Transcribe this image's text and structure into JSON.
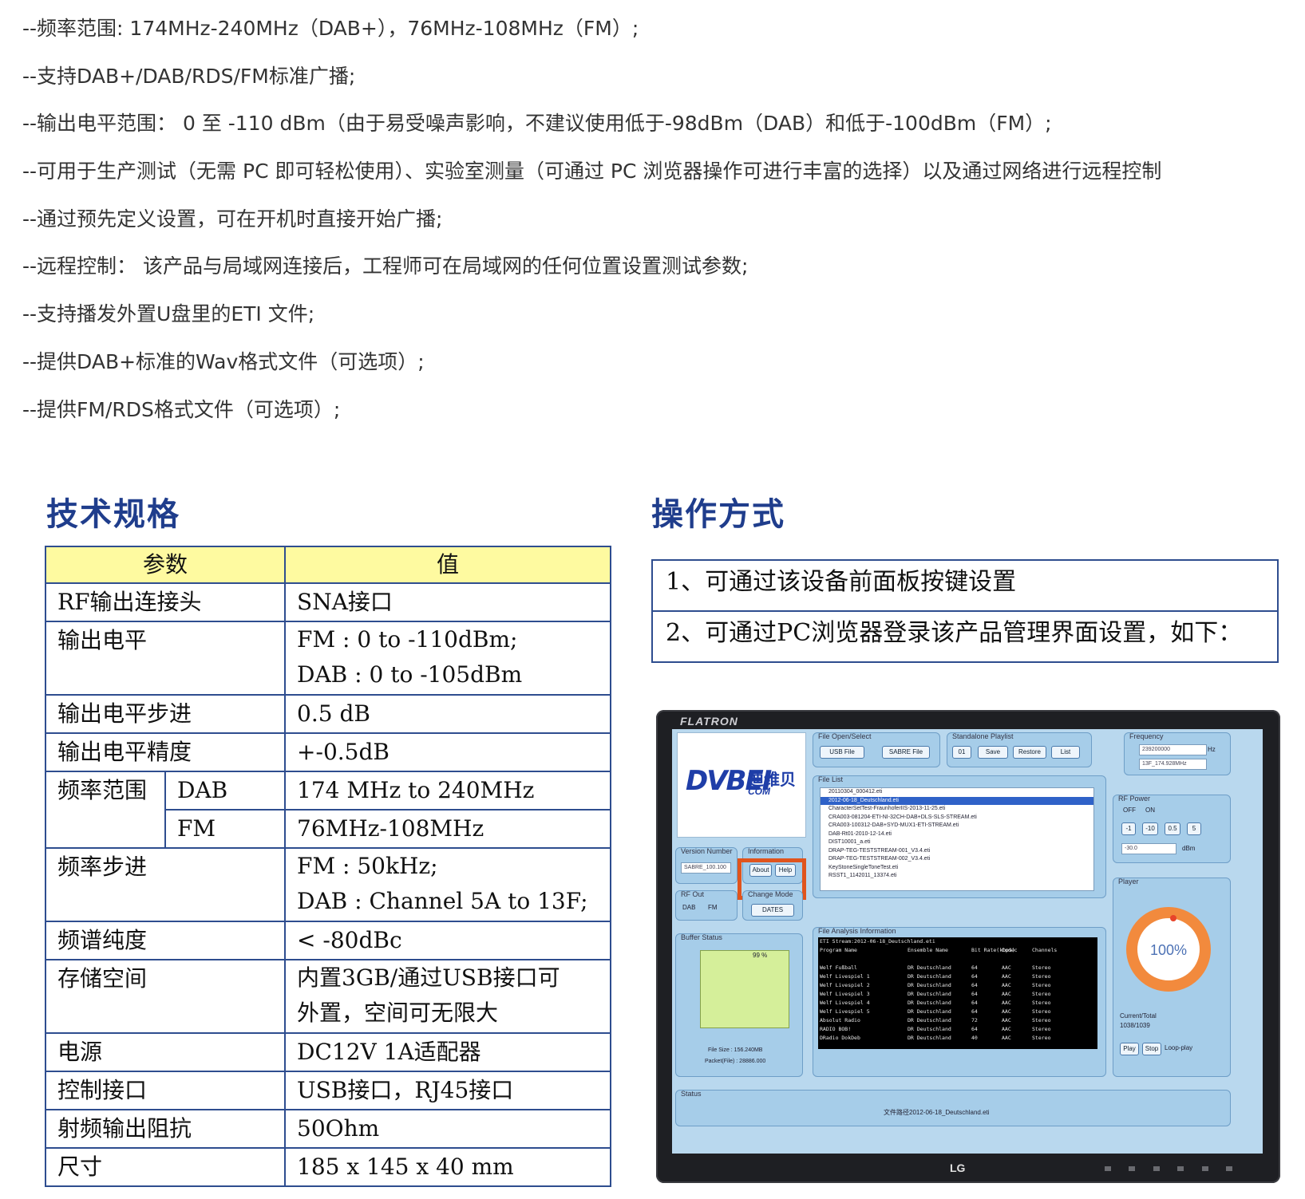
{
  "features": [
    "--频率范围: 174MHz-240MHz（DAB+），76MHz-108MHz（FM）;",
    "--支持DAB+/DAB/RDS/FM标准广播;",
    "--输出电平范围： 0 至 -110 dBm（由于易受噪声影响，不建议使用低于-98dBm（DAB）和低于-100dBm（FM）;",
    "--可用于生产测试（无需 PC 即可轻松使用）、实验室测量（可通过 PC 浏览器操作可进行丰富的选择）以及通过网络进行远程控制",
    "--通过预先定义设置，可在开机时直接开始广播;",
    "--远程控制： 该产品与局域网连接后，工程师可在局域网的任何位置设置测试参数;",
    "--支持播发外置U盘里的ETI 文件;",
    "--提供DAB+标准的Wav格式文件（可选项）;",
    "--提供FM/RDS格式文件（可选项）;"
  ],
  "spec_heading": "技术规格",
  "ops_heading": "操作方式",
  "spec_table": {
    "header": [
      "参数",
      "值"
    ],
    "rows": [
      {
        "param": "RF输出连接头",
        "value": "SNA接口"
      },
      {
        "param": "输出电平",
        "value": "FM : 0 to -110dBm;",
        "value2": "DAB : 0 to -105dBm"
      },
      {
        "param": "输出电平步进",
        "value": "0.5 dB"
      },
      {
        "param": "输出电平精度",
        "value": "+-0.5dB"
      },
      {
        "param": "频率范围",
        "sub1": "DAB",
        "value_dab": "174 MHz to 240MHz",
        "sub2": "FM",
        "value_fm": "76MHz-108MHz"
      },
      {
        "param": "频率步进",
        "value": "FM : 50kHz;",
        "value2": "DAB : Channel 5A to 13F;"
      },
      {
        "param": "频谱纯度",
        "value": "< -80dBc"
      },
      {
        "param": "存储空间",
        "value": "内置3GB/通过USB接口可",
        "value2": "外置，空间可无限大"
      },
      {
        "param": "电源",
        "value": "DC12V 1A适配器"
      },
      {
        "param": "控制接口",
        "value": "USB接口，RJ45接口"
      },
      {
        "param": "射频输出阻抗",
        "value": "50Ohm"
      },
      {
        "param": "尺寸",
        "value": "185 x 145 x 40 mm"
      }
    ]
  },
  "ops": [
    "1、可通过该设备前面板按键设置",
    "2、可通过PC浏览器登录该产品管理界面设置，如下："
  ],
  "monitor": {
    "brand": "FLATRON",
    "maker": "LG",
    "logo": "DVBEI",
    "logo_cn": "迪维贝",
    "logo_sub": "COM",
    "panels": {
      "file_open": "File Open/Select",
      "usb_file": "USB File",
      "sabre_file": "SABRE File",
      "playlist": "Standalone Playlist",
      "playlist_num": "01",
      "save": "Save",
      "restore": "Restore",
      "list": "List",
      "frequency": "Frequency",
      "freq_value": "239200000",
      "freq_unit": "Hz",
      "freq_channel": "13F_174.928MHz",
      "file_list": "File List",
      "rf_power": "RF Power",
      "off": "OFF",
      "on": "ON",
      "step1": "-1",
      "step2": "-10",
      "step3": "0.5",
      "step4": "5",
      "power_value": "-30.0",
      "power_unit": "dBm",
      "version": "Version Number",
      "version_value": "SABRE_100.100",
      "information": "Information",
      "about": "About",
      "help": "Help",
      "rf_out": "RF Out",
      "dab": "DAB",
      "fm": "FM",
      "change_mode": "Change Mode",
      "dates": "DATES",
      "player": "Player",
      "buffer": "Buffer Status",
      "buffer_pct": "99 %",
      "file_size": "File Size : 156.240MB",
      "packet": "Packet(File) : 28886.000",
      "analysis": "File Analysis Information",
      "ring_value": "100%",
      "current_total": "Current/Total",
      "current_total_value": "1038/1039",
      "play": "Play",
      "stop": "Stop",
      "loop": "Loop-play",
      "status": "Status",
      "status_text": "文件路径2012-06-18_Deutschland.eti"
    },
    "files": [
      "20110304_000412.eti",
      "2012-06-18_Deutschland.eti",
      "CharacterSetTest-FraunhoferIIS-2013-11-25.eti",
      "CRA003-081204-ETI-NI-32CH-DAB+DLS-SLS-STREAM.eti",
      "CRA003-100312-DAB+SYD-MUX1-ETI-STREAM.eti",
      "DAB-Rt01-2010-12-14.eti",
      "DIST10001_a.eti",
      "DRAP-TEG-TESTSTREAM-001_V3.4.eti",
      "DRAP-TEG-TESTSTREAM-002_V3.4.eti",
      "KeyStoneSingleToneTest.eti",
      "RSST1_1142011_13374.eti"
    ],
    "analysis_rows": [
      [
        "ETI Stream:2012-06-18_Deutschland.eti",
        "",
        "",
        "",
        ""
      ],
      [
        "Program Name",
        "Ensemble Name",
        "Bit Rate(kbps)",
        "Codec",
        "Channels"
      ],
      [
        "",
        "",
        "",
        "",
        ""
      ],
      [
        "Welf Fußball",
        "DR Deutschland",
        "64",
        "AAC",
        "Stereo"
      ],
      [
        "Welf Livespiel 1",
        "DR Deutschland",
        "64",
        "AAC",
        "Stereo"
      ],
      [
        "Welf Livespiel 2",
        "DR Deutschland",
        "64",
        "AAC",
        "Stereo"
      ],
      [
        "Welf Livespiel 3",
        "DR Deutschland",
        "64",
        "AAC",
        "Stereo"
      ],
      [
        "Welf Livespiel 4",
        "DR Deutschland",
        "64",
        "AAC",
        "Stereo"
      ],
      [
        "Welf Livespiel 5",
        "DR Deutschland",
        "64",
        "AAC",
        "Stereo"
      ],
      [
        "Absolut Radio",
        "DR Deutschland",
        "72",
        "AAC",
        "Stereo"
      ],
      [
        "RADIO BOB!",
        "DR Deutschland",
        "64",
        "AAC",
        "Stereo"
      ],
      [
        "DRadio DokDeb",
        "DR Deutschland",
        "40",
        "AAC",
        "Stereo"
      ]
    ]
  }
}
